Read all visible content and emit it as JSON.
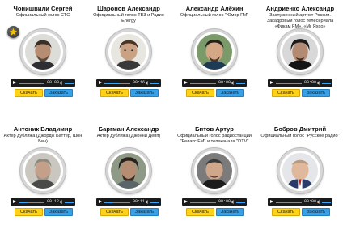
{
  "download_label": "Скачать",
  "order_label": "Заказать",
  "colors": {
    "download": "#ffd21a",
    "order": "#3aa0e6",
    "player": "#1b1b1b",
    "progress": "#35a7ff"
  },
  "voices": [
    {
      "name": "Чонишвили Сергей",
      "desc": "Официальный голос СТС",
      "time": "00:00",
      "progress": 0,
      "featured": true
    },
    {
      "name": "Шаронов Александр",
      "desc": "Официальный голос ТВ3 и Радио Energy",
      "time": "00:16",
      "progress": 0.55,
      "featured": false
    },
    {
      "name": "Александр Алёхин",
      "desc": "Официальный голос \"Юмор FM\"",
      "time": "00:00",
      "progress": 0,
      "featured": false
    },
    {
      "name": "Андриенко Александр",
      "desc": "Заслуженный артист России. Закадровый голос телесериала «Фикам FM». «Мг Яхсо»",
      "time": "00:00",
      "progress": 0,
      "featured": false
    },
    {
      "name": "Антоник Владимир",
      "desc": "Актер дубляжа (Джордж Баттер, Шон Бин)",
      "time": "00:12",
      "progress": 0.3,
      "featured": false
    },
    {
      "name": "Баргман Александр",
      "desc": "Актер дубляжа (Джонни Депп)",
      "time": "00:11",
      "progress": 0.35,
      "featured": false
    },
    {
      "name": "Битов Артур",
      "desc": "Официальный голос радиостанции \"Релакс FM\" и телеканала \"DTV\"",
      "time": "00:00",
      "progress": 0,
      "featured": false
    },
    {
      "name": "Бобров Дмитрий",
      "desc": "Официальный голос \"Русское радио\"",
      "time": "00:00",
      "progress": 0,
      "featured": false
    }
  ]
}
